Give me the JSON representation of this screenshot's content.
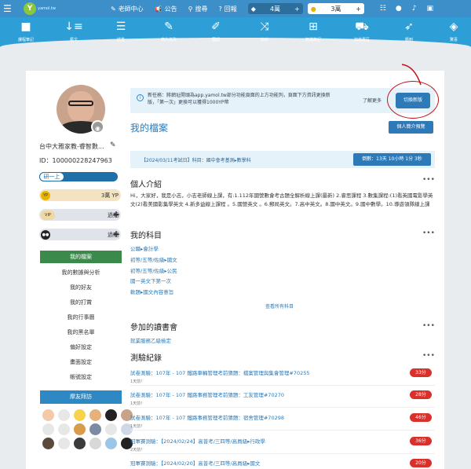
{
  "topbar": {
    "logo": "Y",
    "logo_sub": "yamol.tw",
    "nav": [
      "老師中心",
      "公告",
      "搜尋",
      "回報"
    ],
    "coins": "4萬",
    "points": "3萬"
  },
  "mainnav": [
    "課程筆記",
    "藝文",
    "試卷",
    "寫作批改",
    "國語",
    "白由",
    "知識筆記",
    "加值專區",
    "衝刺",
    "驚喜"
  ],
  "profile": {
    "name": "台中大雅家教-睿智數...",
    "id": "ID：100000228247963",
    "level": "研一上",
    "yp": "3萬 YP",
    "vip": "過期",
    "panda": "過期"
  },
  "sidebar": {
    "items": [
      "我的檔案",
      "我的數據與分析",
      "我的好友",
      "我的打賞",
      "我的行事曆",
      "我的黑名單",
      "偏好設定",
      "畫面設定",
      "帳號設定"
    ],
    "friends": "摩友拜訪"
  },
  "notice": {
    "text": "新任務：將網址開頭為app.yamol.tw部分功能頁面的上方功能列，頁面下方資訊更換新版，「第一次」更換可以獲得1000YP幣",
    "more": "了解更多",
    "switch": "切換新版"
  },
  "main": {
    "title": "我的檔案",
    "intro_btn": "個人簡介預覽",
    "exam_text": "【2024/03/11考試日】科目：國中會考基測▸數學科",
    "countdown": "倒數：13天 10小時 1分 3秒",
    "intro_h": "個人介紹",
    "intro_text": "Hi，大家好，我是小志，小志老師線上課，有:1.112年國營數會考古題全解析線上課(最新) 2.睿思課程 3.數集課程:(1)看英國電影學英文(2)看美國影集學英文 4.新多益線上課程 。5.國營英文 。6.郵局英文。7.高中英文。8.國中英文。9.國中數學。10.導遊領隊線上課",
    "subjects_h": "我的科目",
    "subjects": [
      "公職▸會計學",
      "初等/五等/佐級▸國文",
      "初等/五等/佐級▸公民",
      "國一英文下第一次",
      "軟題▸國文內容意旨"
    ],
    "all_subjects": "查看所有科目",
    "book_h": "參加的讀書會",
    "book_link": "就業服務乙級檢定",
    "quiz_h": "測驗紀錄",
    "quizzes": [
      {
        "t": "試卷測驗：107年 - 107 鐵路車輛管理考前猜題：檔案管理與集會管理#70255",
        "d": "1天前！",
        "s": "33分"
      },
      {
        "t": "試卷測驗：107年 - 107 鐵路事務管理考前猜題：工友管理#70270",
        "d": "1天前！",
        "s": "28分"
      },
      {
        "t": "試卷測驗：107年 - 107 鐵路事務管理考前猜題：宿舍管理#70298",
        "d": "1天前！",
        "s": "46分"
      },
      {
        "t": "冠軍賽測驗：【2024/02/24】高普考/三四等/高員級▸行政學",
        "d": "2天前！",
        "s": "36分"
      },
      {
        "t": "冠軍賽測驗：【2024/02/20】高普考/三四等/高員級▸國文",
        "d": "",
        "s": "20分"
      }
    ]
  }
}
